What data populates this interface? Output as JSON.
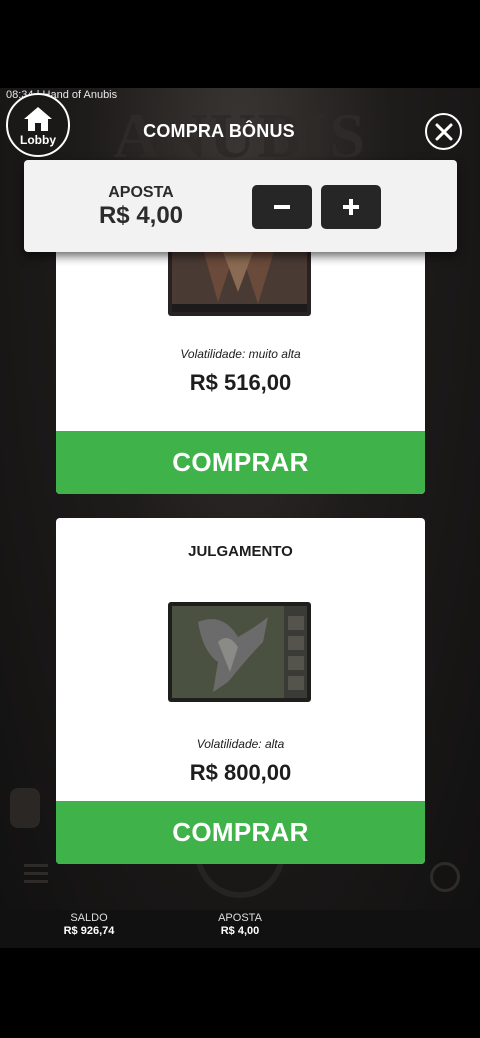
{
  "status_bar": {
    "time": "08:34",
    "game_name": "Hand of Anubis"
  },
  "background": {
    "logo_text": "ANUBIS"
  },
  "lobby": {
    "label": "Lobby",
    "icon": "home-icon"
  },
  "modal": {
    "title": "COMPRA BÔNUS",
    "close_icon": "close-icon"
  },
  "bet": {
    "label": "APOSTA",
    "value": "R$ 4,00",
    "minus_label": "−",
    "plus_label": "+"
  },
  "offers": [
    {
      "title": "",
      "volatility": "Volatilidade: muito alta",
      "price": "R$ 516,00",
      "buy_label": "COMPRAR"
    },
    {
      "title": "JULGAMENTO",
      "volatility": "Volatilidade: alta",
      "price": "R$ 800,00",
      "buy_label": "COMPRAR"
    }
  ],
  "footer": {
    "balance_label": "SALDO",
    "balance_value": "R$ 926,74",
    "bet_label": "APOSTA",
    "bet_value": "R$ 4,00"
  },
  "colors": {
    "accent_green": "#3fb34a",
    "panel": "#f2f2f2",
    "step_button": "#262626"
  }
}
